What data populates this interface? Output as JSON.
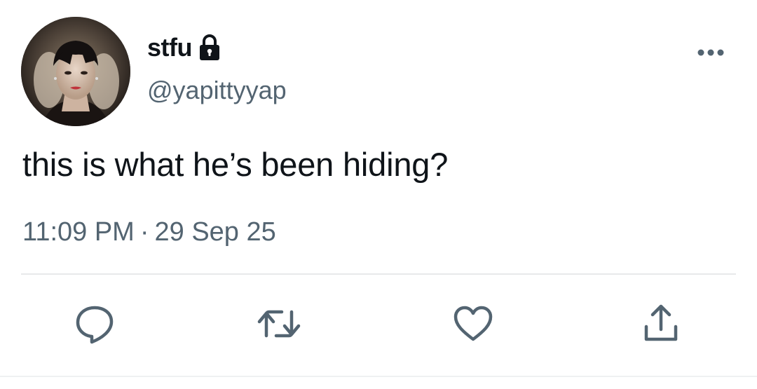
{
  "tweet": {
    "display_name": "stfu",
    "handle": "@yapittyyap",
    "text": "this is what he’s been hiding?",
    "time": "11:09 PM",
    "separator": "·",
    "date": "29 Sep 25",
    "protected": true
  },
  "icons": {
    "lock": "lock-icon",
    "more": "more-horizontal-icon",
    "reply": "reply-icon",
    "retweet": "retweet-icon",
    "like": "heart-icon",
    "share": "share-icon"
  },
  "colors": {
    "text_primary": "#0f1419",
    "text_secondary": "#536471",
    "divider": "#e7e9ea",
    "icon": "#536471"
  }
}
